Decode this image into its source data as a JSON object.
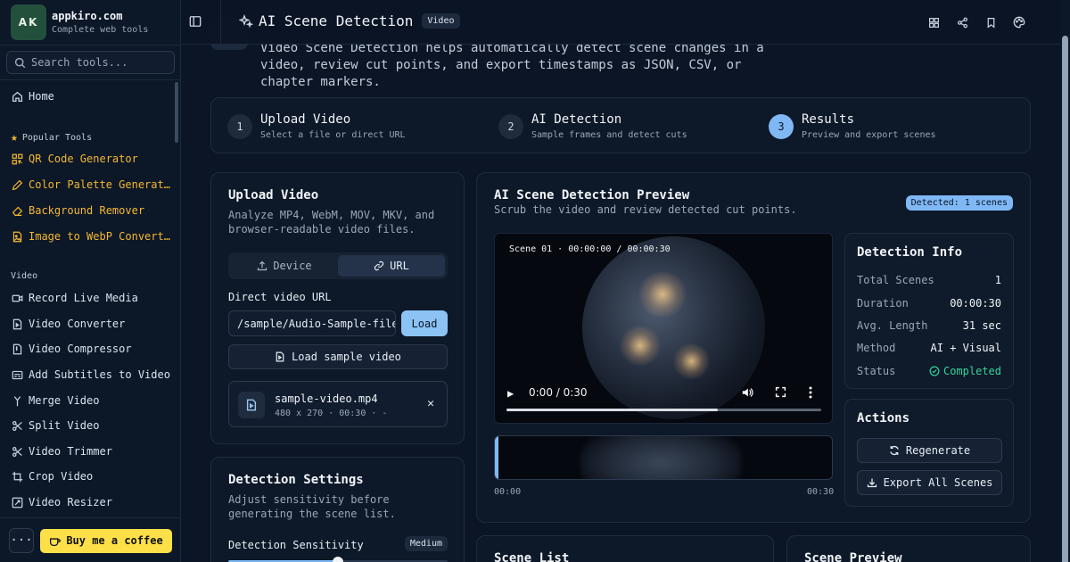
{
  "brand": {
    "logo": "AK",
    "name": "appkiro.com",
    "tagline": "Complete web tools"
  },
  "search": {
    "placeholder": "Search tools..."
  },
  "sidebar": {
    "home": "Home",
    "popular_header": "Popular Tools",
    "popular": [
      "QR Code Generator",
      "Color Palette Generat…",
      "Background Remover",
      "Image to WebP Convert…"
    ],
    "video_header": "Video",
    "video_items": [
      "Record Live Media",
      "Video Converter",
      "Video Compressor",
      "Add Subtitles to Video",
      "Merge Video",
      "Split Video",
      "Video Trimmer",
      "Crop Video",
      "Video Resizer"
    ],
    "more": "···",
    "coffee": "Buy me a coffee"
  },
  "topbar": {
    "title": "AI Scene Detection",
    "badge": "Video"
  },
  "intro": "Video Scene Detection helps automatically detect scene changes in a video, review cut points, and export timestamps as JSON, CSV, or chapter markers.",
  "steps": [
    {
      "num": "1",
      "title": "Upload Video",
      "sub": "Select a file or direct URL"
    },
    {
      "num": "2",
      "title": "AI Detection",
      "sub": "Sample frames and detect cuts"
    },
    {
      "num": "3",
      "title": "Results",
      "sub": "Preview and export scenes"
    }
  ],
  "upload": {
    "title": "Upload Video",
    "sub": "Analyze MP4, WebM, MOV, MKV, and browser-readable video files.",
    "tab_device": "Device",
    "tab_url": "URL",
    "url_label": "Direct video URL",
    "url_value": "/sample/Audio-Sample-file",
    "load": "Load",
    "sample": "Load sample video",
    "file_name": "sample-video.mp4",
    "file_meta": "480 x 270 · 00:30 · -"
  },
  "settings": {
    "title": "Detection Settings",
    "sub": "Adjust sensitivity before generating the scene list.",
    "sens_label": "Detection Sensitivity",
    "sens_value": "Medium",
    "sens_level": 0.5
  },
  "preview": {
    "title": "AI Scene Detection Preview",
    "sub": "Scrub the video and review detected cut points.",
    "badge": "Detected: 1 scenes",
    "scene_label": "Scene 01 · 00:00:00 / 00:00:30",
    "video_time": "0:00 / 0:30",
    "progress": 0.67,
    "tl_start": "00:00",
    "tl_end": "00:30"
  },
  "info": {
    "title": "Detection Info",
    "rows": [
      {
        "k": "Total Scenes",
        "v": "1"
      },
      {
        "k": "Duration",
        "v": "00:00:30"
      },
      {
        "k": "Avg. Length",
        "v": "31 sec"
      },
      {
        "k": "Method",
        "v": "AI + Visual"
      },
      {
        "k": "Status",
        "v": "Completed"
      }
    ]
  },
  "actions": {
    "title": "Actions",
    "regenerate": "Regenerate",
    "export": "Export All Scenes"
  },
  "bottom": {
    "scene_list": "Scene List",
    "scene_preview": "Scene Preview"
  }
}
